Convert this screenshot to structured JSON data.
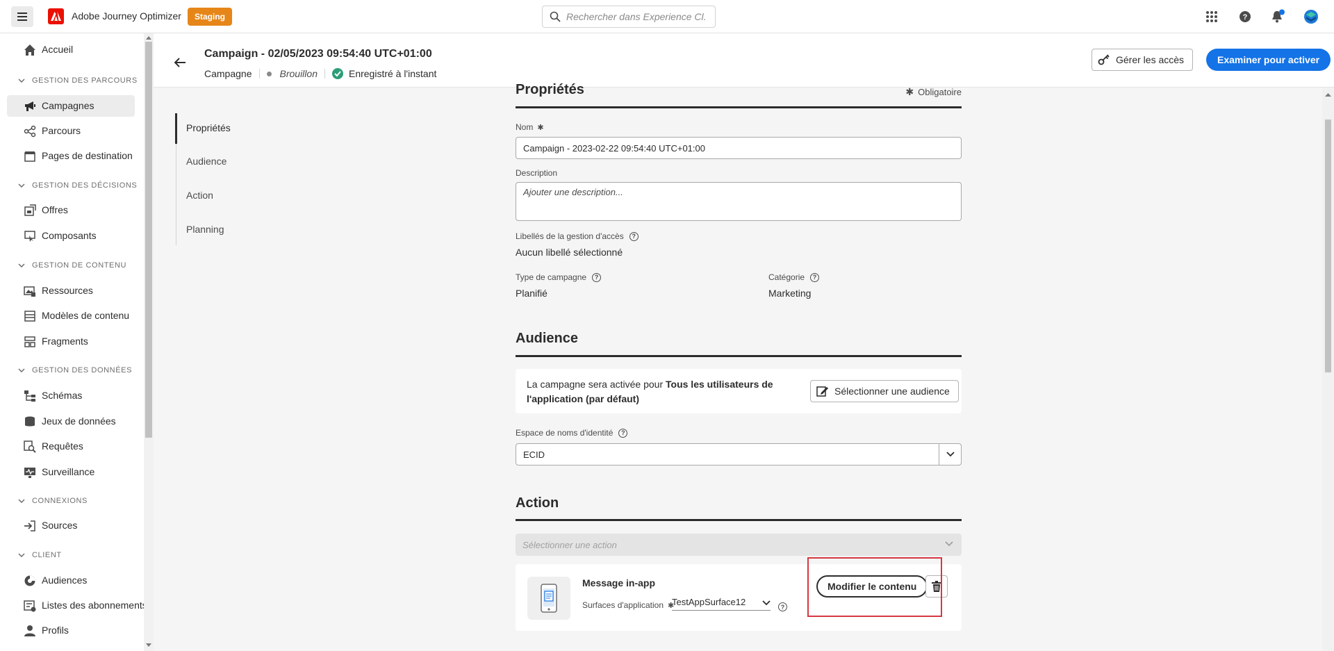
{
  "app": {
    "title": "Adobe Journey Optimizer",
    "environment": "Staging",
    "search_placeholder": "Rechercher dans Experience Cl..."
  },
  "sidebar": {
    "items": [
      {
        "label": "Accueil",
        "icon": "home-icon"
      },
      {
        "section": "GESTION DES PARCOURS"
      },
      {
        "label": "Campagnes",
        "icon": "megaphone-icon",
        "active": true
      },
      {
        "label": "Parcours",
        "icon": "journey-icon"
      },
      {
        "label": "Pages de destination",
        "icon": "landing-page-icon"
      },
      {
        "section": "GESTION DES DÉCISIONS"
      },
      {
        "label": "Offres",
        "icon": "offers-icon"
      },
      {
        "label": "Composants",
        "icon": "components-icon"
      },
      {
        "section": "GESTION DE CONTENU"
      },
      {
        "label": "Ressources",
        "icon": "assets-icon"
      },
      {
        "label": "Modèles de contenu",
        "icon": "templates-icon"
      },
      {
        "label": "Fragments",
        "icon": "fragments-icon"
      },
      {
        "section": "GESTION DES DONNÉES"
      },
      {
        "label": "Schémas",
        "icon": "schemas-icon"
      },
      {
        "label": "Jeux de données",
        "icon": "datasets-icon"
      },
      {
        "label": "Requêtes",
        "icon": "queries-icon"
      },
      {
        "label": "Surveillance",
        "icon": "monitoring-icon"
      },
      {
        "section": "CONNEXIONS"
      },
      {
        "label": "Sources",
        "icon": "sources-icon"
      },
      {
        "section": "CLIENT"
      },
      {
        "label": "Audiences",
        "icon": "audiences-icon"
      },
      {
        "label": "Listes des abonnements",
        "icon": "subscriptions-icon"
      },
      {
        "label": "Profils",
        "icon": "profile-icon"
      }
    ]
  },
  "header": {
    "title": "Campaign - 02/05/2023 09:54:40 UTC+01:00",
    "type": "Campagne",
    "status": "Brouillon",
    "saved": "Enregistré à l'instant",
    "manage_access": "Gérer les accès",
    "review": "Examiner pour activer"
  },
  "inner_nav": [
    "Propriétés",
    "Audience",
    "Action",
    "Planning"
  ],
  "properties": {
    "title": "Propriétés",
    "required": "Obligatoire",
    "name_label": "Nom",
    "name_value": "Campaign - 2023-02-22 09:54:40 UTC+01:00",
    "description_label": "Description",
    "description_placeholder": "Ajouter une description...",
    "access_labels_label": "Libellés de la gestion d'accès",
    "access_labels_value": "Aucun libellé sélectionné",
    "campaign_type_label": "Type de campagne",
    "campaign_type_value": "Planifié",
    "category_label": "Catégorie",
    "category_value": "Marketing"
  },
  "audience": {
    "title": "Audience",
    "text_prefix": "La campagne sera activée pour ",
    "text_bold": "Tous les utilisateurs de l'application (par défaut)",
    "select_button": "Sélectionner une audience",
    "namespace_label": "Espace de noms d'identité",
    "namespace_value": "ECID"
  },
  "action": {
    "title": "Action",
    "select_placeholder": "Sélectionner une action",
    "channel": "Message in-app",
    "surface_label": "Surfaces d'application",
    "surface_value": "TestAppSurface12",
    "edit_button": "Modifier le contenu"
  },
  "colors": {
    "accent": "#1473e6",
    "brand": "#eb1000",
    "staging": "#e68619",
    "success": "#2d9d78",
    "highlight": "#d7373f"
  }
}
